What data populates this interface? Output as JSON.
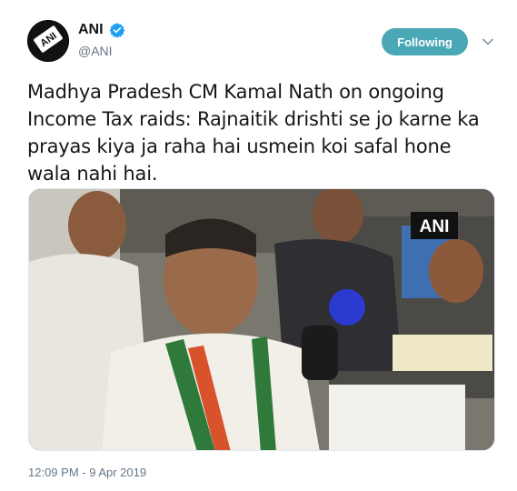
{
  "tweet": {
    "author": {
      "display_name": "ANI",
      "handle": "@ANI",
      "verified": true,
      "avatar_text": "ANI"
    },
    "follow_button_label": "Following",
    "text": "Madhya Pradesh CM Kamal Nath on ongoing Income Tax raids: Rajnaitik drishti se jo karne ka prayas kiya ja raha hai usmein koi safal hone wala nahi hai.",
    "media": {
      "watermark": "ANI"
    },
    "timestamp": "12:09 PM - 9 Apr 2019"
  },
  "colors": {
    "follow_button": "#4aa8b6",
    "verified_badge": "#1da1f2",
    "secondary_text": "#657786"
  },
  "icons": {
    "verified": "verified-badge-icon",
    "menu": "chevron-down-icon"
  }
}
